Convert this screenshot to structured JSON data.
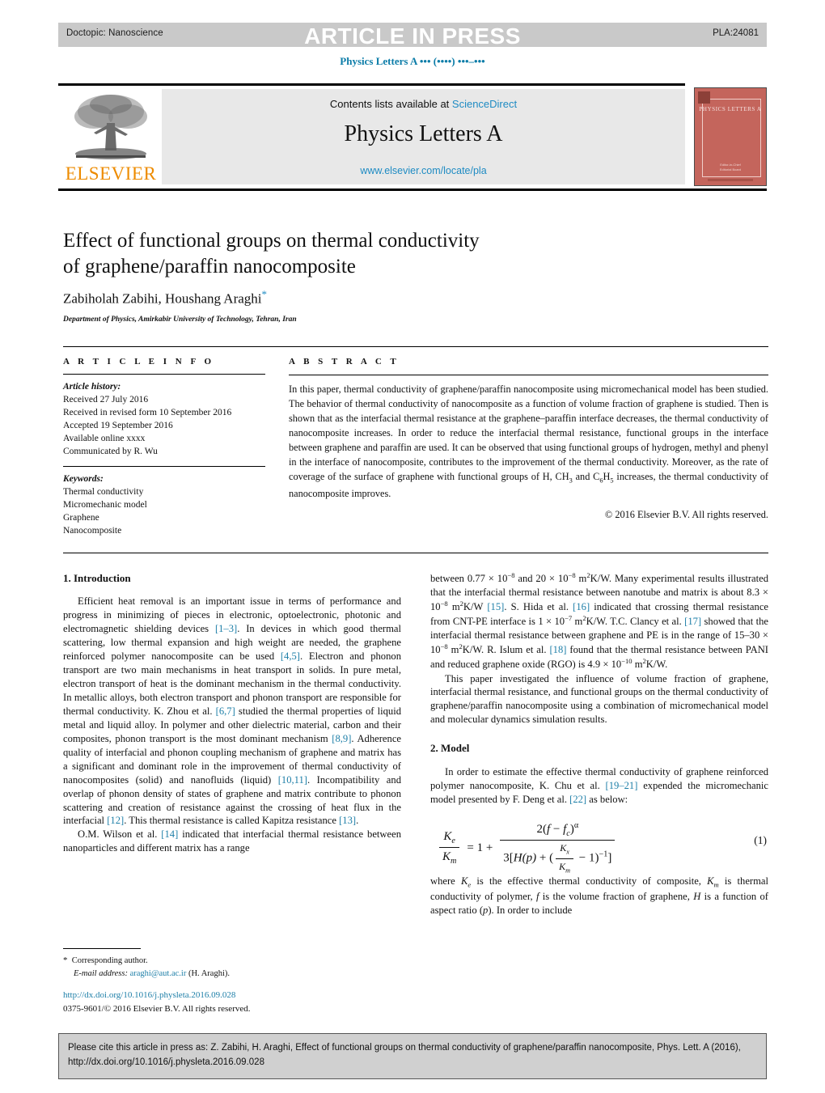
{
  "running_head": {
    "doctopic": "Doctopic: Nanoscience",
    "article_in_press": "ARTICLE IN PRESS",
    "article_id": "PLA:24081",
    "journal_ref": "Physics Letters A ••• (••••) •••–•••"
  },
  "masthead": {
    "contents_prefix": "Contents lists available at ",
    "sciencedirect": "ScienceDirect",
    "journal_title": "Physics Letters A",
    "journal_url": "www.elsevier.com/locate/pla",
    "publisher": "ELSEVIER",
    "cover_title": "PHYSICS LETTERS A",
    "cover_footer_line1": "Editor-in-Chief",
    "cover_footer_line2": "Editorial Board"
  },
  "article": {
    "title_line1": "Effect of functional groups on thermal conductivity",
    "title_line2": "of graphene/paraffin nanocomposite",
    "authors": "Zabiholah Zabihi, Houshang Araghi",
    "corresponding_marker": "*",
    "affiliation": "Department of Physics, Amirkabir University of Technology, Tehran, Iran"
  },
  "article_info": {
    "heading": "A R T I C L E   I N F O",
    "history_label": "Article history:",
    "history": [
      "Received 27 July 2016",
      "Received in revised form 10 September 2016",
      "Accepted 19 September 2016",
      "Available online xxxx",
      "Communicated by R. Wu"
    ],
    "keywords_label": "Keywords:",
    "keywords": [
      "Thermal conductivity",
      "Micromechanic model",
      "Graphene",
      "Nanocomposite"
    ]
  },
  "abstract": {
    "heading": "A B S T R A C T",
    "text_part1": "In this paper, thermal conductivity of graphene/paraffin nanocomposite using micromechanical model has been studied. The behavior of thermal conductivity of nanocomposite as a function of volume fraction of graphene is studied. Then is shown that as the interfacial thermal resistance at the graphene–paraffin interface decreases, the thermal conductivity of nanocomposite increases. In order to reduce the interfacial thermal resistance, functional groups in the interface between graphene and paraffin are used. It can be observed that using functional groups of hydrogen, methyl and phenyl in the interface of nanocomposite, contributes to the improvement of the thermal conductivity. Moreover, as the rate of coverage of the surface of graphene with functional groups of H, CH",
    "sub1": "3",
    "text_part2": " and C",
    "sub2": "6",
    "text_part3": "H",
    "sub3": "5",
    "text_part4": " increases, the thermal conductivity of nanocomposite improves.",
    "copyright": "© 2016 Elsevier B.V. All rights reserved."
  },
  "sections": {
    "introduction_heading": "1. Introduction",
    "model_heading": "2. Model"
  },
  "body_left": {
    "p1_a": "Efficient heat removal is an important issue in terms of performance and progress in minimizing of pieces in electronic, optoelectronic, photonic and electromagnetic shielding devices ",
    "r1": "[1–3]",
    "p1_b": ". In devices in which good thermal scattering, low thermal expansion and high weight are needed, the graphene reinforced polymer nanocomposite can be used ",
    "r2": "[4,5]",
    "p1_c": ". Electron and phonon transport are two main mechanisms in heat transport in solids. In pure metal, electron transport of heat is the dominant mechanism in the thermal conductivity. In metallic alloys, both electron transport and phonon transport are responsible for thermal conductivity. K. Zhou et al. ",
    "r3": "[6,7]",
    "p1_d": " studied the thermal properties of liquid metal and liquid alloy. In polymer and other dielectric material, carbon and their composites, phonon transport is the most dominant mechanism ",
    "r4": "[8,9]",
    "p1_e": ". Adherence quality of interfacial and phonon coupling mechanism of graphene and matrix has a significant and dominant role in the improvement of thermal conductivity of nanocomposites (solid) and nanofluids (liquid) ",
    "r5": "[10,11]",
    "p1_f": ". Incompatibility and overlap of phonon density of states of graphene and matrix contribute to phonon scattering and creation of resistance against the crossing of heat flux in the interfacial ",
    "r6": "[12]",
    "p1_g": ". This thermal resistance is called Kapitza resistance ",
    "r7": "[13]",
    "p1_h": ".",
    "p2_a": "O.M. Wilson et al. ",
    "r8": "[14]",
    "p2_b": " indicated that interfacial thermal resistance between nanoparticles and different matrix has a range"
  },
  "body_right": {
    "p1_a": "between 0.77 × 10",
    "e1": "−8",
    "p1_b": " and 20 × 10",
    "e2": "−8",
    "p1_c": " m",
    "e3": "2",
    "p1_d": "K/W. Many experimental results illustrated that the interfacial thermal resistance between nanotube and matrix is about 8.3 × 10",
    "e4": "−8",
    "p1_e": " m",
    "e5": "2",
    "p1_f": "K/W ",
    "r15": "[15]",
    "p1_g": ". S. Hida et al. ",
    "r16": "[16]",
    "p1_h": " indicated that crossing thermal resistance from CNT-PE interface is 1 × 10",
    "e6": "−7",
    "p1_i": " m",
    "e7": "2",
    "p1_j": "K/W. T.C. Clancy et al. ",
    "r17": "[17]",
    "p1_k": " showed that the interfacial thermal resistance between graphene and PE is in the range of 15–30 × 10",
    "e8": "−8",
    "p1_l": " m",
    "e9": "2",
    "p1_m": "K/W. R. Islum et al. ",
    "r18": "[18]",
    "p1_n": " found that the thermal resistance between PANI and reduced graphene oxide (RGO) is 4.9 × 10",
    "e10": "−10",
    "p1_o": " m",
    "e11": "2",
    "p1_p": "K/W.",
    "p2": "This paper investigated the influence of volume fraction of graphene, interfacial thermal resistance, and functional groups on the thermal conductivity of graphene/paraffin nanocomposite using a combination of micromechanical model and molecular dynamics simulation results.",
    "p3_a": "In order to estimate the effective thermal conductivity of graphene reinforced polymer nanocomposite, K. Chu et al. ",
    "r19": "[19–21]",
    "p3_b": " expended the micromechanic model presented by F. Deng et al. ",
    "r22": "[22]",
    "p3_c": " as below:",
    "p4_a": "where ",
    "sym_ke": "K",
    "sub_e": "e",
    "p4_b": " is the effective thermal conductivity of composite, ",
    "sym_km": "K",
    "sub_m": "m",
    "p4_c": " is thermal conductivity of polymer, ",
    "sym_f": "f",
    "p4_d": " is the volume fraction of graphene, ",
    "sym_h": "H",
    "p4_e": " is a function of aspect ratio (",
    "sym_p": "p",
    "p4_f": "). In order to include"
  },
  "equation": {
    "lhs_num": "K",
    "lhs_num_sub": "e",
    "lhs_den": "K",
    "lhs_den_sub": "m",
    "equals": "= 1 +",
    "rhs_num_pre": "2(",
    "rhs_num_f": "f",
    "rhs_num_minus": " − ",
    "rhs_num_fc": "f",
    "rhs_num_fc_sub": "c",
    "rhs_num_post": ")",
    "rhs_num_alpha": "α",
    "rhs_den_pre": "3[",
    "rhs_den_h": "H",
    "rhs_den_p": "(p)",
    "rhs_den_plus": " + (",
    "rhs_den_kx": "K",
    "rhs_den_kx_sub": "x",
    "rhs_den_km": "K",
    "rhs_den_km_sub": "m",
    "rhs_den_minus1": " − 1)",
    "rhs_den_exp": "−1",
    "rhs_den_close": "]",
    "number": "(1)"
  },
  "footnote": {
    "star": "*",
    "corresponding": "Corresponding author.",
    "email_label": "E-mail address:",
    "email": "araghi@aut.ac.ir",
    "email_owner": "(H. Araghi).",
    "doi": "http://dx.doi.org/10.1016/j.physleta.2016.09.028",
    "issn_line": "0375-9601/© 2016 Elsevier B.V. All rights reserved."
  },
  "citation_footer": {
    "line1": "Please cite this article in press as: Z. Zabihi, H. Araghi, Effect of functional groups on thermal conductivity of graphene/paraffin nanocomposite, Phys. Lett. A (2016),",
    "line2": "http://dx.doi.org/10.1016/j.physleta.2016.09.028"
  },
  "colors": {
    "link": "#1e7fa8",
    "elsevier_orange": "#ed8b00",
    "band_gray": "#c9c9c9",
    "cover_red": "#c4655c"
  }
}
